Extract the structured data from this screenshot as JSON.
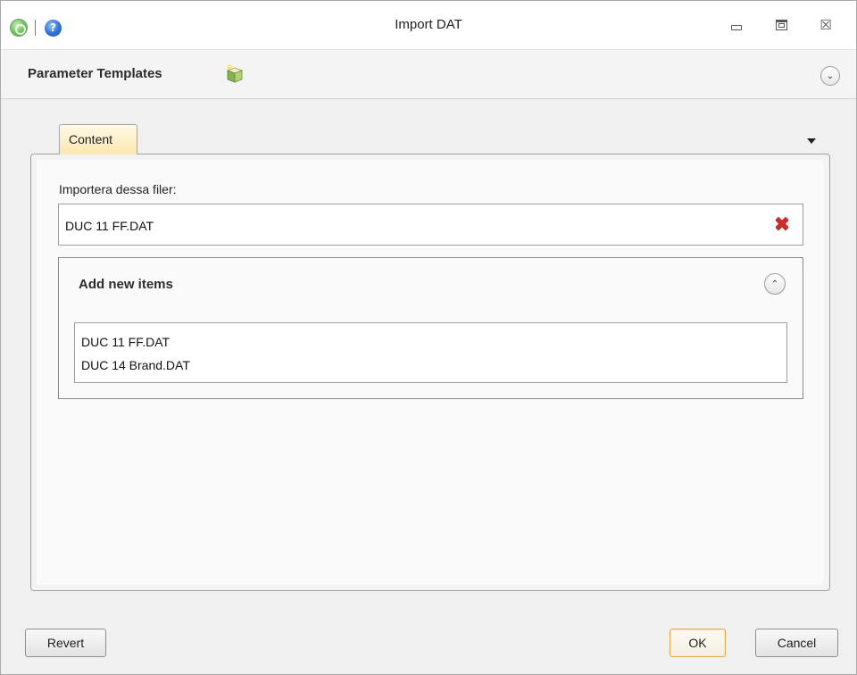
{
  "window": {
    "title": "Import DAT",
    "icons": {
      "app": "app-globe-icon",
      "help": "help-icon",
      "help_glyph": "?",
      "minimize": "minimize-icon",
      "maximize": "maximize-icon",
      "close": "close-icon",
      "close_glyph": "☒"
    }
  },
  "header": {
    "title": "Parameter Templates",
    "template_icon": "template-package-icon",
    "collapse_glyph": "⌄"
  },
  "tabs": [
    {
      "label": "Content",
      "selected": true
    }
  ],
  "content": {
    "import_label": "Importera dessa filer:",
    "file_value": "DUC 11 FF.DAT",
    "clear_icon": "red-x-clear-icon",
    "clear_glyph": "✖",
    "group": {
      "title": "Add new items",
      "collapse_glyph": "⌃",
      "items": [
        "DUC 11 FF.DAT",
        "DUC 14 Brand.DAT"
      ]
    }
  },
  "footer": {
    "revert_label": "Revert",
    "ok_label": "OK",
    "cancel_label": "Cancel"
  },
  "colors": {
    "tab_selected": "#fce7b0",
    "ok_border": "#e0a84a",
    "clear_icon": "#d12b2b"
  }
}
